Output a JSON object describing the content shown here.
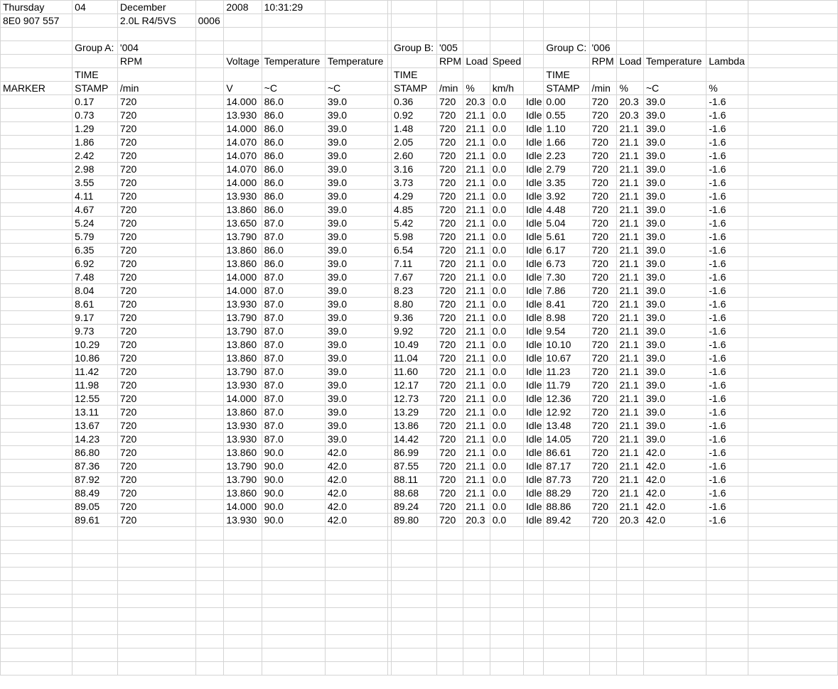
{
  "sheet": {
    "header_rows": [
      [
        "Thursday",
        "04",
        "December",
        "",
        "2008",
        "10:31:29",
        "",
        "",
        "",
        "",
        "",
        "",
        "",
        "",
        "",
        "",
        "",
        "",
        ""
      ],
      [
        "8E0 907 557",
        "",
        "2.0L R4/5VS",
        "0006",
        "",
        "",
        "",
        "",
        "",
        "",
        "",
        "",
        "",
        "",
        "",
        "",
        "",
        "",
        ""
      ],
      [
        "",
        "",
        "",
        "",
        "",
        "",
        "",
        "",
        "",
        "",
        "",
        "",
        "",
        "",
        "",
        "",
        "",
        "",
        ""
      ],
      [
        "",
        "Group A:",
        "'004",
        "",
        "",
        "",
        "",
        "",
        "Group B:",
        "'005",
        "",
        "",
        "",
        "Group C:",
        "'006",
        "",
        "",
        "",
        ""
      ],
      [
        "",
        "",
        "RPM",
        "",
        "Voltage",
        "Temperature",
        "Temperature",
        "",
        "",
        "RPM",
        "Load",
        "Speed",
        "",
        "",
        "RPM",
        "Load",
        "Temperature",
        "Lambda",
        ""
      ],
      [
        "",
        "TIME",
        "",
        "",
        "",
        "",
        "",
        "",
        "TIME",
        "",
        "",
        "",
        "",
        "TIME",
        "",
        "",
        "",
        "",
        ""
      ],
      [
        "MARKER",
        "STAMP",
        "/min",
        "",
        "V",
        "~C",
        "~C",
        "",
        "STAMP",
        "/min",
        "%",
        "km/h",
        "",
        "STAMP",
        "/min",
        "%",
        "~C",
        "%",
        ""
      ]
    ],
    "data_rows": [
      [
        "",
        "0.17",
        "720",
        "",
        "14.000",
        "86.0",
        "39.0",
        "",
        "0.36",
        "720",
        "20.3",
        "0.0",
        "Idle",
        "0.00",
        "720",
        "20.3",
        "39.0",
        "-1.6",
        ""
      ],
      [
        "",
        "0.73",
        "720",
        "",
        "13.930",
        "86.0",
        "39.0",
        "",
        "0.92",
        "720",
        "21.1",
        "0.0",
        "Idle",
        "0.55",
        "720",
        "20.3",
        "39.0",
        "-1.6",
        ""
      ],
      [
        "",
        "1.29",
        "720",
        "",
        "14.000",
        "86.0",
        "39.0",
        "",
        "1.48",
        "720",
        "21.1",
        "0.0",
        "Idle",
        "1.10",
        "720",
        "21.1",
        "39.0",
        "-1.6",
        ""
      ],
      [
        "",
        "1.86",
        "720",
        "",
        "14.070",
        "86.0",
        "39.0",
        "",
        "2.05",
        "720",
        "21.1",
        "0.0",
        "Idle",
        "1.66",
        "720",
        "21.1",
        "39.0",
        "-1.6",
        ""
      ],
      [
        "",
        "2.42",
        "720",
        "",
        "14.070",
        "86.0",
        "39.0",
        "",
        "2.60",
        "720",
        "21.1",
        "0.0",
        "Idle",
        "2.23",
        "720",
        "21.1",
        "39.0",
        "-1.6",
        ""
      ],
      [
        "",
        "2.98",
        "720",
        "",
        "14.070",
        "86.0",
        "39.0",
        "",
        "3.16",
        "720",
        "21.1",
        "0.0",
        "Idle",
        "2.79",
        "720",
        "21.1",
        "39.0",
        "-1.6",
        ""
      ],
      [
        "",
        "3.55",
        "720",
        "",
        "14.000",
        "86.0",
        "39.0",
        "",
        "3.73",
        "720",
        "21.1",
        "0.0",
        "Idle",
        "3.35",
        "720",
        "21.1",
        "39.0",
        "-1.6",
        ""
      ],
      [
        "",
        "4.11",
        "720",
        "",
        "13.930",
        "86.0",
        "39.0",
        "",
        "4.29",
        "720",
        "21.1",
        "0.0",
        "Idle",
        "3.92",
        "720",
        "21.1",
        "39.0",
        "-1.6",
        ""
      ],
      [
        "",
        "4.67",
        "720",
        "",
        "13.860",
        "86.0",
        "39.0",
        "",
        "4.85",
        "720",
        "21.1",
        "0.0",
        "Idle",
        "4.48",
        "720",
        "21.1",
        "39.0",
        "-1.6",
        ""
      ],
      [
        "",
        "5.24",
        "720",
        "",
        "13.650",
        "87.0",
        "39.0",
        "",
        "5.42",
        "720",
        "21.1",
        "0.0",
        "Idle",
        "5.04",
        "720",
        "21.1",
        "39.0",
        "-1.6",
        ""
      ],
      [
        "",
        "5.79",
        "720",
        "",
        "13.790",
        "87.0",
        "39.0",
        "",
        "5.98",
        "720",
        "21.1",
        "0.0",
        "Idle",
        "5.61",
        "720",
        "21.1",
        "39.0",
        "-1.6",
        ""
      ],
      [
        "",
        "6.35",
        "720",
        "",
        "13.860",
        "86.0",
        "39.0",
        "",
        "6.54",
        "720",
        "21.1",
        "0.0",
        "Idle",
        "6.17",
        "720",
        "21.1",
        "39.0",
        "-1.6",
        ""
      ],
      [
        "",
        "6.92",
        "720",
        "",
        "13.860",
        "86.0",
        "39.0",
        "",
        "7.11",
        "720",
        "21.1",
        "0.0",
        "Idle",
        "6.73",
        "720",
        "21.1",
        "39.0",
        "-1.6",
        ""
      ],
      [
        "",
        "7.48",
        "720",
        "",
        "14.000",
        "87.0",
        "39.0",
        "",
        "7.67",
        "720",
        "21.1",
        "0.0",
        "Idle",
        "7.30",
        "720",
        "21.1",
        "39.0",
        "-1.6",
        ""
      ],
      [
        "",
        "8.04",
        "720",
        "",
        "14.000",
        "87.0",
        "39.0",
        "",
        "8.23",
        "720",
        "21.1",
        "0.0",
        "Idle",
        "7.86",
        "720",
        "21.1",
        "39.0",
        "-1.6",
        ""
      ],
      [
        "",
        "8.61",
        "720",
        "",
        "13.930",
        "87.0",
        "39.0",
        "",
        "8.80",
        "720",
        "21.1",
        "0.0",
        "Idle",
        "8.41",
        "720",
        "21.1",
        "39.0",
        "-1.6",
        ""
      ],
      [
        "",
        "9.17",
        "720",
        "",
        "13.790",
        "87.0",
        "39.0",
        "",
        "9.36",
        "720",
        "21.1",
        "0.0",
        "Idle",
        "8.98",
        "720",
        "21.1",
        "39.0",
        "-1.6",
        ""
      ],
      [
        "",
        "9.73",
        "720",
        "",
        "13.790",
        "87.0",
        "39.0",
        "",
        "9.92",
        "720",
        "21.1",
        "0.0",
        "Idle",
        "9.54",
        "720",
        "21.1",
        "39.0",
        "-1.6",
        ""
      ],
      [
        "",
        "10.29",
        "720",
        "",
        "13.860",
        "87.0",
        "39.0",
        "",
        "10.49",
        "720",
        "21.1",
        "0.0",
        "Idle",
        "10.10",
        "720",
        "21.1",
        "39.0",
        "-1.6",
        ""
      ],
      [
        "",
        "10.86",
        "720",
        "",
        "13.860",
        "87.0",
        "39.0",
        "",
        "11.04",
        "720",
        "21.1",
        "0.0",
        "Idle",
        "10.67",
        "720",
        "21.1",
        "39.0",
        "-1.6",
        ""
      ],
      [
        "",
        "11.42",
        "720",
        "",
        "13.790",
        "87.0",
        "39.0",
        "",
        "11.60",
        "720",
        "21.1",
        "0.0",
        "Idle",
        "11.23",
        "720",
        "21.1",
        "39.0",
        "-1.6",
        ""
      ],
      [
        "",
        "11.98",
        "720",
        "",
        "13.930",
        "87.0",
        "39.0",
        "",
        "12.17",
        "720",
        "21.1",
        "0.0",
        "Idle",
        "11.79",
        "720",
        "21.1",
        "39.0",
        "-1.6",
        ""
      ],
      [
        "",
        "12.55",
        "720",
        "",
        "14.000",
        "87.0",
        "39.0",
        "",
        "12.73",
        "720",
        "21.1",
        "0.0",
        "Idle",
        "12.36",
        "720",
        "21.1",
        "39.0",
        "-1.6",
        ""
      ],
      [
        "",
        "13.11",
        "720",
        "",
        "13.860",
        "87.0",
        "39.0",
        "",
        "13.29",
        "720",
        "21.1",
        "0.0",
        "Idle",
        "12.92",
        "720",
        "21.1",
        "39.0",
        "-1.6",
        ""
      ],
      [
        "",
        "13.67",
        "720",
        "",
        "13.930",
        "87.0",
        "39.0",
        "",
        "13.86",
        "720",
        "21.1",
        "0.0",
        "Idle",
        "13.48",
        "720",
        "21.1",
        "39.0",
        "-1.6",
        ""
      ],
      [
        "",
        "14.23",
        "720",
        "",
        "13.930",
        "87.0",
        "39.0",
        "",
        "14.42",
        "720",
        "21.1",
        "0.0",
        "Idle",
        "14.05",
        "720",
        "21.1",
        "39.0",
        "-1.6",
        ""
      ],
      [
        "",
        "86.80",
        "720",
        "",
        "13.860",
        "90.0",
        "42.0",
        "",
        "86.99",
        "720",
        "21.1",
        "0.0",
        "Idle",
        "86.61",
        "720",
        "21.1",
        "42.0",
        "-1.6",
        ""
      ],
      [
        "",
        "87.36",
        "720",
        "",
        "13.790",
        "90.0",
        "42.0",
        "",
        "87.55",
        "720",
        "21.1",
        "0.0",
        "Idle",
        "87.17",
        "720",
        "21.1",
        "42.0",
        "-1.6",
        ""
      ],
      [
        "",
        "87.92",
        "720",
        "",
        "13.790",
        "90.0",
        "42.0",
        "",
        "88.11",
        "720",
        "21.1",
        "0.0",
        "Idle",
        "87.73",
        "720",
        "21.1",
        "42.0",
        "-1.6",
        ""
      ],
      [
        "",
        "88.49",
        "720",
        "",
        "13.860",
        "90.0",
        "42.0",
        "",
        "88.68",
        "720",
        "21.1",
        "0.0",
        "Idle",
        "88.29",
        "720",
        "21.1",
        "42.0",
        "-1.6",
        ""
      ],
      [
        "",
        "89.05",
        "720",
        "",
        "14.000",
        "90.0",
        "42.0",
        "",
        "89.24",
        "720",
        "21.1",
        "0.0",
        "Idle",
        "88.86",
        "720",
        "21.1",
        "42.0",
        "-1.6",
        ""
      ],
      [
        "",
        "89.61",
        "720",
        "",
        "13.930",
        "90.0",
        "42.0",
        "",
        "89.80",
        "720",
        "20.3",
        "0.0",
        "Idle",
        "89.42",
        "720",
        "20.3",
        "42.0",
        "-1.6",
        ""
      ]
    ]
  }
}
